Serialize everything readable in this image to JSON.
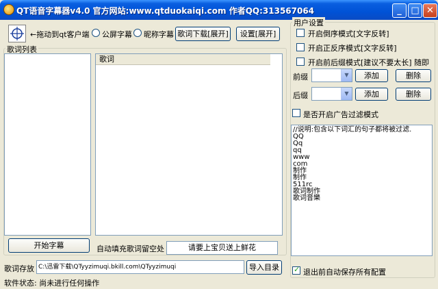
{
  "window": {
    "title": "QT语音字幕器v4.0 官方网站:www.qtduokaiqi.com   作者QQ:313567064"
  },
  "controls": {
    "minimize": "_",
    "maximize": "□",
    "close": "✕"
  },
  "toolbar": {
    "drag_label": "←拖动到qt客户端",
    "radio_public": "公屏字幕",
    "radio_nickname": "昵称字幕",
    "lyrics_download_button": "歌词下载[展开]",
    "settings_button": "设置[展开]"
  },
  "lyrics_list": {
    "group_title": "歌词列表"
  },
  "lyrics_panel": {
    "header": "歌词"
  },
  "actions": {
    "start_button": "开始字幕",
    "autofill_label": "自动填充歌词留空处",
    "autofill_value": "请要上宝贝送上鲜花"
  },
  "storage": {
    "label": "歌词存放",
    "path_value": "C:\\迅雷下载\\QTyyzimuqi.bkill.com\\QTyyzimuqi",
    "import_button": "导入目录"
  },
  "status": {
    "text": "软件状态: 尚未进行任何操作"
  },
  "user_settings": {
    "group_title": "用户设置",
    "option_reverse": "开启倒序模式[文字反转]",
    "option_forward": "开启正反序模式[文字反转]",
    "option_prefix_suffix": "开启前后缀模式[建议不要太长] 随即",
    "prefix_label": "前缀",
    "suffix_label": "后缀",
    "add_button": "添加",
    "delete_button": "删除",
    "ad_filter_label": "是否开启广告过滤模式",
    "filter_lines": [
      "//说明:包含以下词汇的句子都将被过滤.",
      "QQ",
      "Qq",
      "qq",
      "www",
      "com",
      "制作",
      "制作",
      "511rc",
      "歌词制作",
      "歌词音樂"
    ],
    "autosave_label": "退出前自动保存所有配置",
    "autosave_checked": true
  }
}
